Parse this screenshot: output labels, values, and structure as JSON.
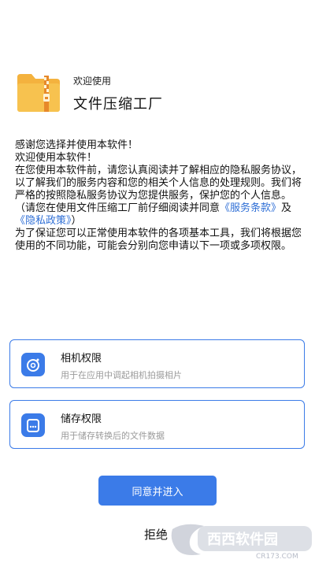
{
  "header": {
    "welcome": "欢迎使用",
    "app_name": "文件压缩工厂"
  },
  "content": {
    "line1": "感谢您选择并使用本软件！",
    "line2": "欢迎使用本软件！",
    "para1_before": "在您使用本软件前，请您认真阅读并了解相应的隐私服务协议，以了解我们的服务内容和您的相关个人信息的处理规则。我们将严格的按照隐私服务协议为您提供服务，保护您的个人信息。（请您在使用文件压缩工厂前仔细阅读并同意",
    "service_link": "《服务条款》",
    "conj": "及",
    "privacy_link": "《隐私政策》",
    "para1_after": "）",
    "para2": "为了保证您可以正常使用本软件的各项基本工具，我们将根据您使用的不同功能，可能会分别向您申请以下一项或多项权限。"
  },
  "permissions": [
    {
      "title": "相机权限",
      "desc": "用于在应用中调起相机拍摄相片",
      "icon": "camera-icon"
    },
    {
      "title": "储存权限",
      "desc": "用于储存转换后的文件数据",
      "icon": "storage-icon"
    }
  ],
  "actions": {
    "agree": "同意并进入",
    "refuse": "拒绝"
  },
  "watermark": {
    "text": "西西软件园",
    "url": "CR173.COM"
  },
  "colors": {
    "accent": "#3b7be8",
    "folder": "#f4b23e"
  }
}
